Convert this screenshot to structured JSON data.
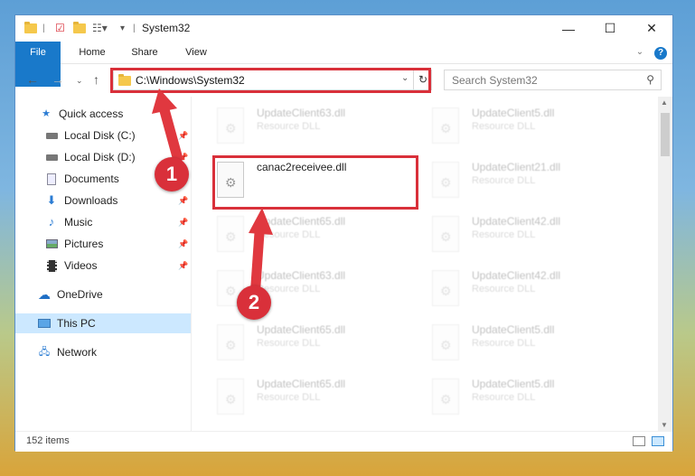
{
  "window": {
    "title": "System32"
  },
  "ribbon": {
    "tabs": [
      "File",
      "Home",
      "Share",
      "View"
    ]
  },
  "address": {
    "path": "C:\\Windows\\System32"
  },
  "search": {
    "placeholder": "Search System32"
  },
  "sidebar": {
    "items": [
      {
        "label": "Quick access",
        "icon": "star-icon"
      },
      {
        "label": "Local Disk (C:)",
        "icon": "drive-icon",
        "pinned": true
      },
      {
        "label": "Local Disk (D:)",
        "icon": "drive-icon",
        "pinned": true
      },
      {
        "label": "Documents",
        "icon": "documents-icon",
        "pinned": true
      },
      {
        "label": "Downloads",
        "icon": "download-icon",
        "pinned": true
      },
      {
        "label": "Music",
        "icon": "music-icon",
        "pinned": true
      },
      {
        "label": "Pictures",
        "icon": "pictures-icon",
        "pinned": true
      },
      {
        "label": "Videos",
        "icon": "videos-icon",
        "pinned": true
      },
      {
        "label": "OneDrive",
        "icon": "cloud-icon"
      },
      {
        "label": "This PC",
        "icon": "computer-icon",
        "selected": true
      },
      {
        "label": "Network",
        "icon": "network-icon"
      }
    ]
  },
  "files": {
    "left": [
      {
        "name": "UpdateClient63.dll",
        "type": "Resource DLL"
      },
      {
        "name": "canac2receivee.dll",
        "type": ""
      },
      {
        "name": "UpdateClient65.dll",
        "type": "Resource DLL"
      },
      {
        "name": "UpdateClient63.dll",
        "type": "Resource DLL"
      },
      {
        "name": "UpdateClient65.dll",
        "type": "Resource DLL"
      },
      {
        "name": "UpdateClient65.dll",
        "type": "Resource DLL"
      }
    ],
    "right": [
      {
        "name": "UpdateClient5.dll",
        "type": "Resource DLL"
      },
      {
        "name": "UpdateClient21.dll",
        "type": "Resource DLL"
      },
      {
        "name": "UpdateClient42.dll",
        "type": "Resource DLL"
      },
      {
        "name": "UpdateClient42.dll",
        "type": "Resource DLL"
      },
      {
        "name": "UpdateClient5.dll",
        "type": "Resource DLL"
      },
      {
        "name": "UpdateClient5.dll",
        "type": "Resource DLL"
      }
    ]
  },
  "status": {
    "items_count": "152 items"
  },
  "annotations": {
    "marker1": "1",
    "marker2": "2"
  },
  "colors": {
    "accent": "#1979ca",
    "highlight": "#d9303a",
    "selected": "#cce8ff"
  }
}
